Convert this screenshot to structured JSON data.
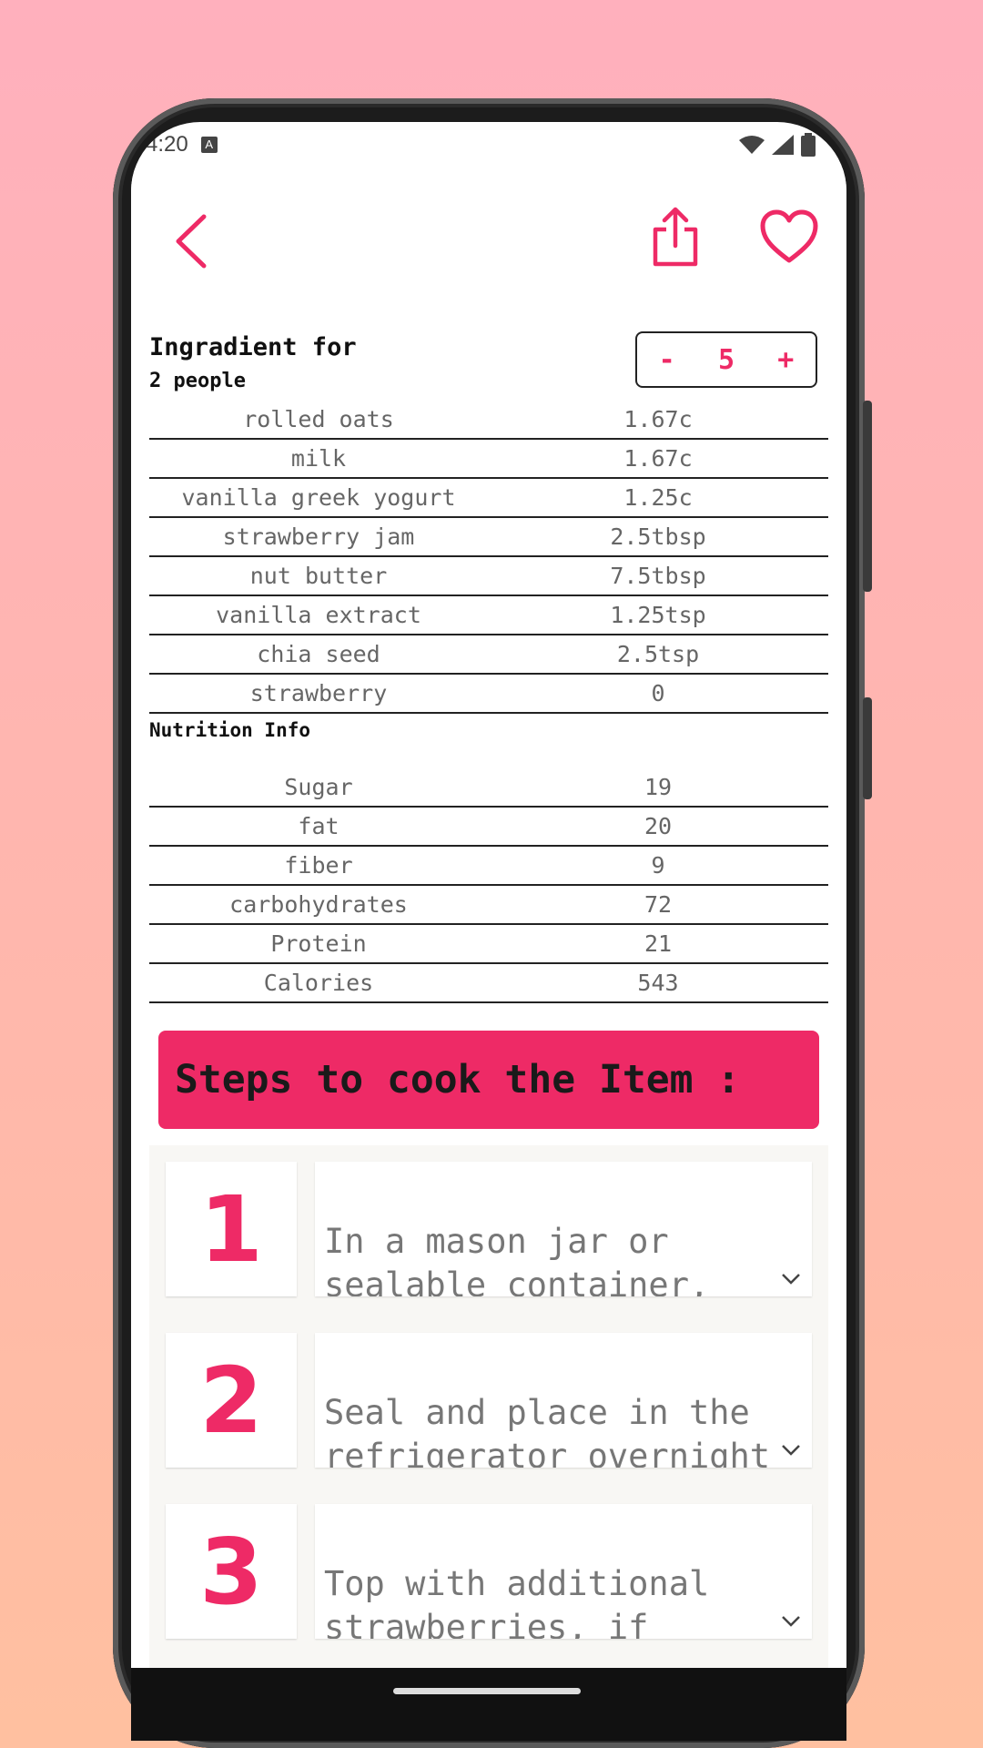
{
  "status": {
    "time": "4:20",
    "badge": "A"
  },
  "colors": {
    "accent": "#ee2a66"
  },
  "header": {
    "icons": [
      "back-chevron-icon",
      "share-icon",
      "heart-icon"
    ]
  },
  "ingredients": {
    "title": "Ingradient for",
    "subtitle": "2 people",
    "servings": {
      "minus": "-",
      "value": "5",
      "plus": "+"
    },
    "rows": [
      {
        "name": "rolled oats",
        "amount": "1.67c"
      },
      {
        "name": "milk",
        "amount": "1.67c"
      },
      {
        "name": "vanilla greek yogurt",
        "amount": "1.25c"
      },
      {
        "name": "strawberry jam",
        "amount": "2.5tbsp"
      },
      {
        "name": "nut butter",
        "amount": "7.5tbsp"
      },
      {
        "name": "vanilla extract",
        "amount": "1.25tsp"
      },
      {
        "name": "chia seed",
        "amount": "2.5tsp"
      },
      {
        "name": "strawberry",
        "amount": "0"
      }
    ]
  },
  "nutrition": {
    "title": "Nutrition Info",
    "rows": [
      {
        "name": "Sugar",
        "amount": "19"
      },
      {
        "name": "fat",
        "amount": "20"
      },
      {
        "name": "fiber",
        "amount": "9"
      },
      {
        "name": "carbohydrates",
        "amount": "72"
      },
      {
        "name": "Protein",
        "amount": "21"
      },
      {
        "name": "Calories",
        "amount": "543"
      }
    ]
  },
  "steps": {
    "title": "Steps to cook the Item :",
    "items": [
      {
        "num": "1",
        "text": "In a mason jar or\nsealable container,"
      },
      {
        "num": "2",
        "text": "Seal and place in the\nrefrigerator overnight"
      },
      {
        "num": "3",
        "text": "Top with additional\nstrawberries, if"
      }
    ]
  }
}
